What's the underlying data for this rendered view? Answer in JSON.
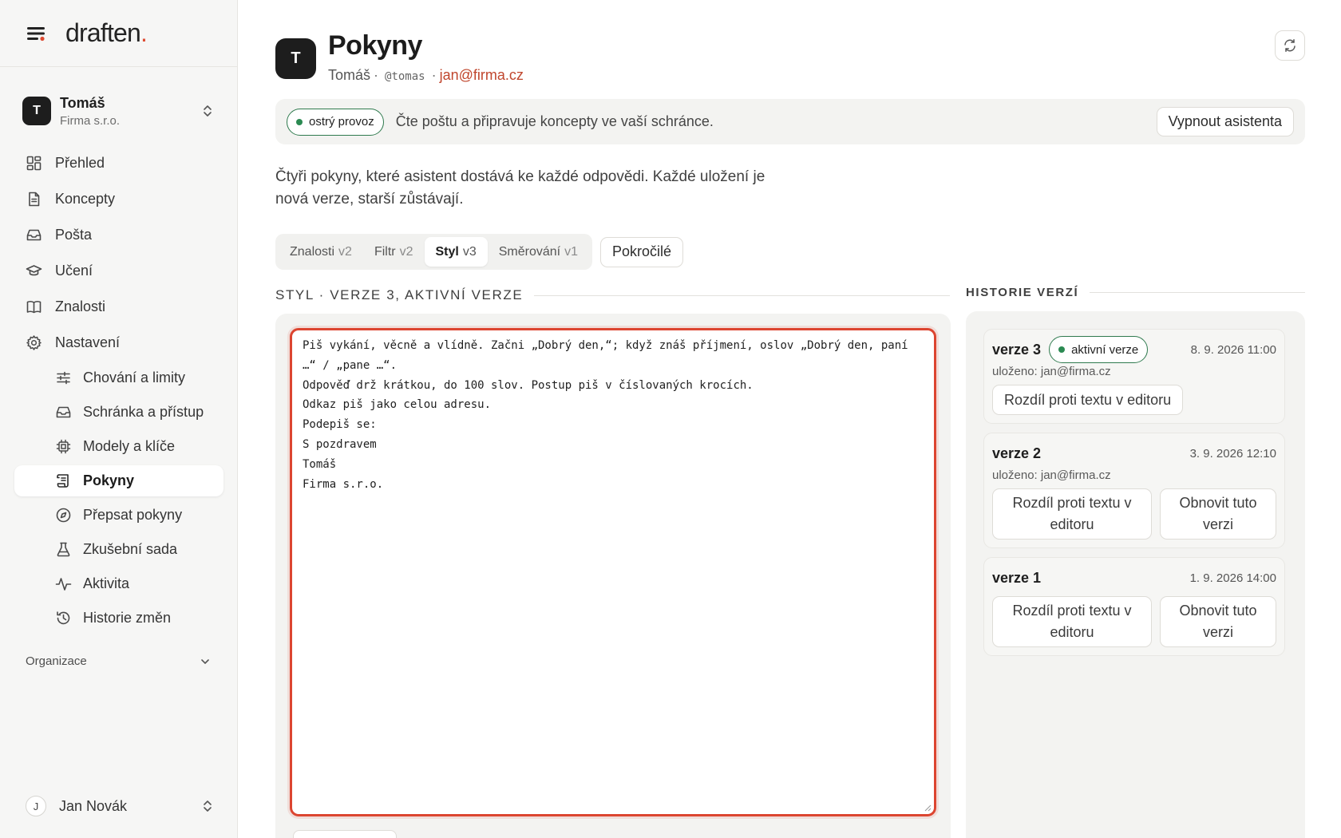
{
  "brand": {
    "name": "draften",
    "dot": ".",
    "accent": "#de4b32"
  },
  "account": {
    "initial": "T",
    "name": "Tomáš",
    "org": "Firma s.r.o."
  },
  "nav": {
    "items": [
      {
        "label": "Přehled",
        "icon": "grid-icon"
      },
      {
        "label": "Koncepty",
        "icon": "document-icon"
      },
      {
        "label": "Pošta",
        "icon": "inbox-icon"
      },
      {
        "label": "Učení",
        "icon": "graduation-cap-icon"
      },
      {
        "label": "Znalosti",
        "icon": "book-icon"
      },
      {
        "label": "Nastavení",
        "icon": "gear-icon"
      }
    ],
    "sub_items": [
      {
        "label": "Chování a limity",
        "icon": "sliders-icon"
      },
      {
        "label": "Schránka a přístup",
        "icon": "inbox-icon"
      },
      {
        "label": "Modely a klíče",
        "icon": "chip-icon"
      },
      {
        "label": "Pokyny",
        "icon": "scroll-icon",
        "active": true
      },
      {
        "label": "Přepsat pokyny",
        "icon": "compass-icon"
      },
      {
        "label": "Zkušební sada",
        "icon": "flask-icon"
      },
      {
        "label": "Aktivita",
        "icon": "activity-icon"
      },
      {
        "label": "Historie změn",
        "icon": "history-icon"
      }
    ],
    "section_org": "Organizace"
  },
  "user": {
    "initial": "J",
    "name": "Jan Novák"
  },
  "header": {
    "initial": "T",
    "title": "Pokyny",
    "owner": "Tomáš",
    "handle": "@tomas",
    "email": "jan@firma.cz",
    "separator": "·"
  },
  "status": {
    "badge": "ostrý provoz",
    "text": "Čte poštu a připravuje koncepty ve vaší schránce.",
    "off_button": "Vypnout asistenta"
  },
  "intro": "Čtyři pokyny, které asistent dostává ke každé odpovědi. Každé uložení je nová verze, starší zůstávají.",
  "tabs": [
    {
      "label": "Znalosti",
      "version": "v2"
    },
    {
      "label": "Filtr",
      "version": "v2"
    },
    {
      "label": "Styl",
      "version": "v3",
      "active": true
    },
    {
      "label": "Směrování",
      "version": "v1"
    }
  ],
  "advanced_button": "Pokročilé",
  "editor": {
    "heading": "STYL · VERZE 3, AKTIVNÍ VERZE",
    "content": "Piš vykání, věcně a vlídně. Začni „Dobrý den,“; když znáš příjmení, oslov „Dobrý den, paní …“ / „pane …“.\nOdpověď drž krátkou, do 100 slov. Postup piš v číslovaných krocích.\nOdkaz piš jako celou adresu.\nPodepiš se:\nS pozdravem\nTomáš\nFirma s.r.o."
  },
  "history": {
    "heading": "HISTORIE VERZÍ",
    "versions": [
      {
        "label": "verze 3",
        "badge": "aktivní verze",
        "date": "8. 9. 2026 11:00",
        "saved": "uloženo: jan@firma.cz",
        "diff": "Rozdíl proti textu v editoru"
      },
      {
        "label": "verze 2",
        "date": "3. 9. 2026 12:10",
        "saved": "uloženo: jan@firma.cz",
        "diff": "Rozdíl proti textu v editoru",
        "restore": "Obnovit tuto verzi"
      },
      {
        "label": "verze 1",
        "date": "1. 9. 2026 14:00",
        "diff": "Rozdíl proti textu v editoru",
        "restore": "Obnovit tuto verzi"
      }
    ]
  },
  "colors": {
    "active_green": "#2b8a52",
    "editor_focus": "#dc4530",
    "email": "#c0462d"
  }
}
